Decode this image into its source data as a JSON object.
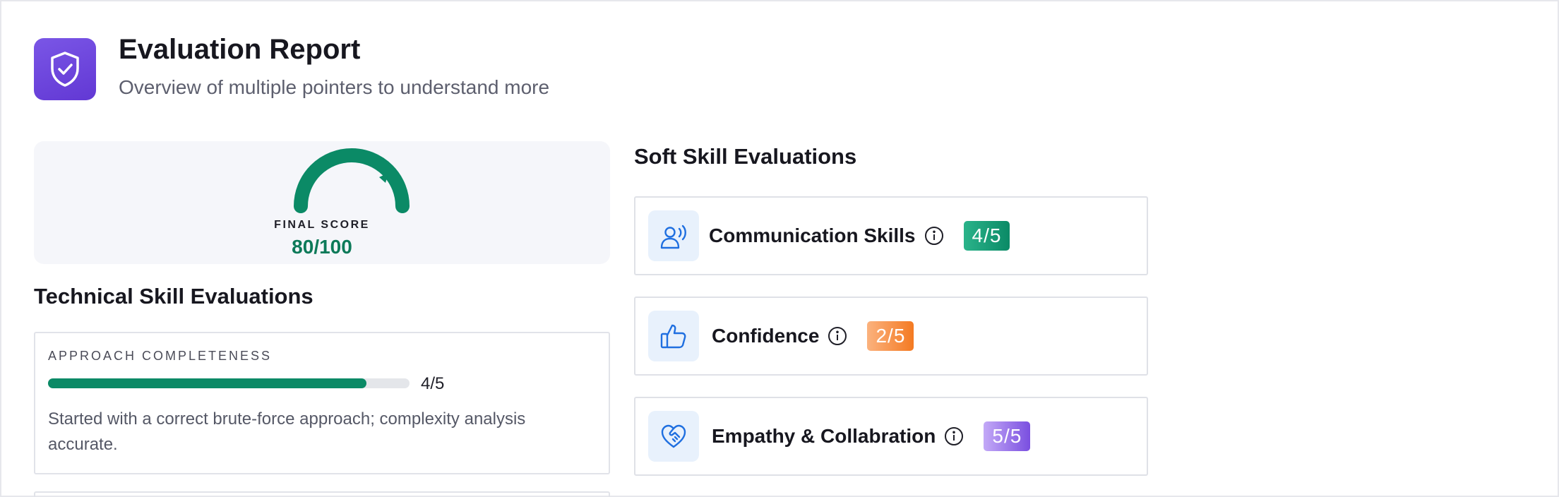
{
  "header": {
    "icon": "shield-check-icon",
    "title": "Evaluation Report",
    "subtitle": "Overview of multiple pointers to understand more"
  },
  "final_score": {
    "label": "FINAL SCORE",
    "value_text": "80/100",
    "value": 80,
    "max": 100,
    "gauge_color": "#0b8a66"
  },
  "technical": {
    "title": "Technical Skill Evaluations",
    "items": [
      {
        "name": "APPROACH COMPLETENESS",
        "score_text": "4/5",
        "progress_percent": 88,
        "description": "Started with a correct brute-force approach; complexity analysis accurate."
      }
    ]
  },
  "soft": {
    "title": "Soft Skill Evaluations",
    "items": [
      {
        "label": "Communication Skills",
        "icon": "speaking-person-icon",
        "badge": "4/5",
        "badge_color": "#0b8a66"
      },
      {
        "label": "Confidence",
        "icon": "thumbs-up-icon",
        "badge": "2/5",
        "badge_color": "#f47a22"
      },
      {
        "label": "Empathy & Collabration",
        "icon": "heart-handshake-icon",
        "badge": "5/5",
        "badge_color": "#7a4fe0"
      }
    ]
  },
  "colors": {
    "accent_purple": "#6238d4",
    "brand_green": "#0b8a66",
    "icon_blue": "#1f6fe0"
  }
}
